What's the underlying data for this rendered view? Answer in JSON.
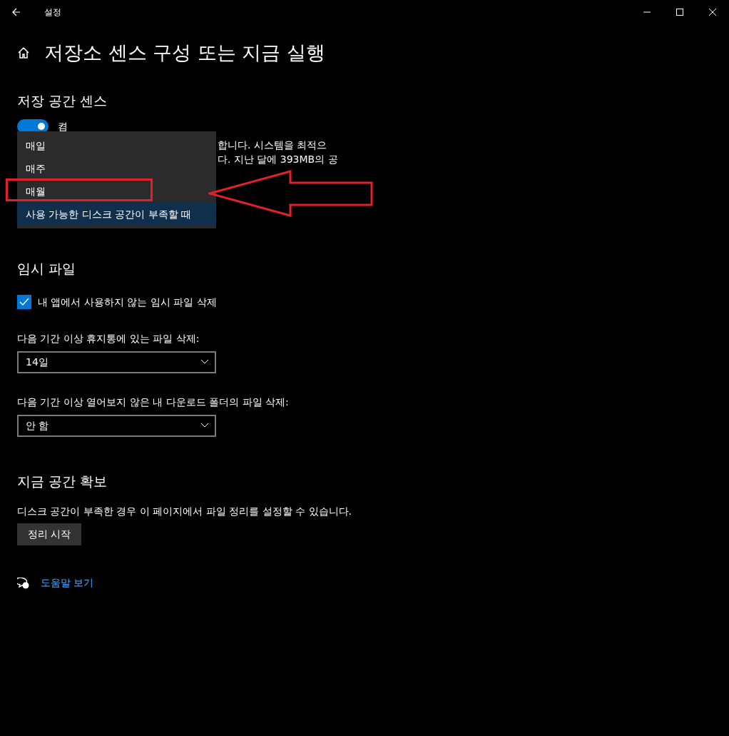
{
  "window": {
    "title": "설정"
  },
  "page_title": "저장소 센스 구성 또는 지금 실행",
  "storage_sense": {
    "heading": "저장 공간 센스",
    "toggle": {
      "on": true,
      "label": "켬"
    },
    "description_lines": [
      "합니다. 시스템을 최적으",
      "다. 지난 달에 393MB의 공"
    ],
    "dropdown_menu": [
      {
        "label": "매일",
        "selected": false,
        "annotated": false
      },
      {
        "label": "매주",
        "selected": false,
        "annotated": false
      },
      {
        "label": "매월",
        "selected": false,
        "annotated": true
      },
      {
        "label": "사용 가능한 디스크 공간이 부족할 때",
        "selected": true,
        "annotated": false
      }
    ]
  },
  "temp_files": {
    "heading": "임시 파일",
    "checkbox": {
      "label": "내 앱에서 사용하지 않는 임시 파일 삭제",
      "checked": true
    },
    "selects": [
      {
        "label": "다음 기간 이상 휴지통에 있는 파일 삭제:",
        "value": "14일"
      },
      {
        "label": "다음 기간 이상 열어보지 않은 내 다운로드 폴더의 파일 삭제:",
        "value": "안 함"
      }
    ]
  },
  "free_space": {
    "heading": "지금 공간 확보",
    "description": "디스크 공간이 부족한 경우 이 페이지에서 파일 정리를 설정할 수 있습니다.",
    "button": "정리 시작"
  },
  "help_link": "도움말 보기"
}
